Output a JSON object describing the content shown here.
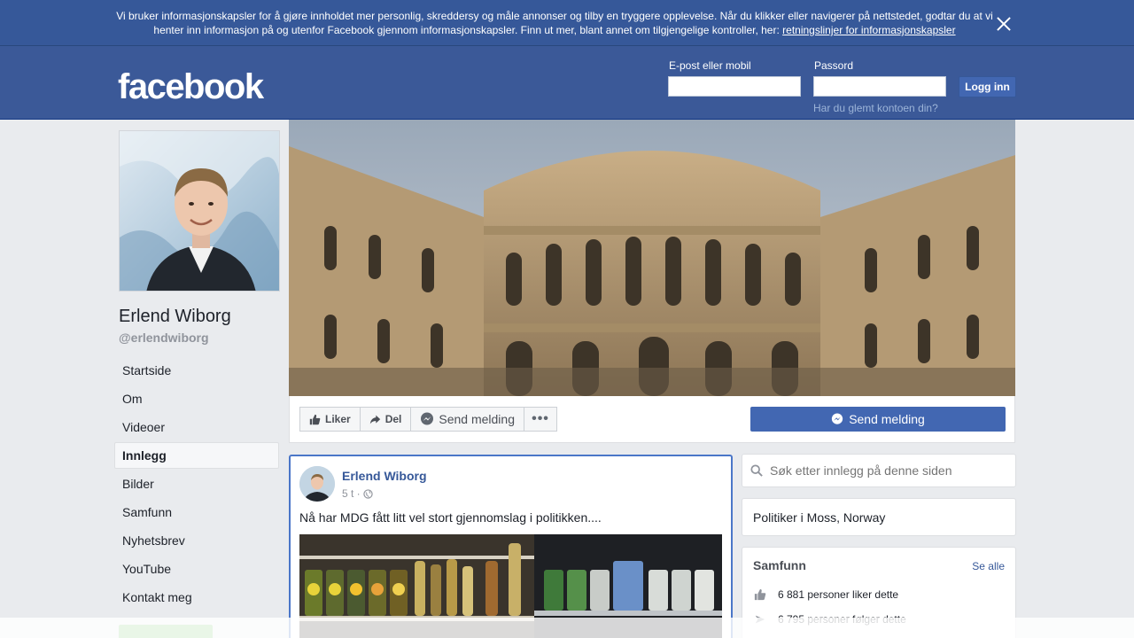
{
  "cookie_banner": {
    "text": "Vi bruker informasjonskapsler for å gjøre innholdet mer personlig, skreddersy og måle annonser og tilby en tryggere opplevelse. Når du klikker eller navigerer på nettstedet, godtar du at vi henter inn informasjon på og utenfor Facebook gjennom informasjonskapsler. Finn ut mer, blant annet om tilgjengelige kontroller, her: ",
    "link": "retningslinjer for informasjonskapsler"
  },
  "header": {
    "logo": "facebook",
    "email_label": "E-post eller mobil",
    "password_label": "Passord",
    "login_button": "Logg inn",
    "forgot": "Har du glemt kontoen din?"
  },
  "profile": {
    "name": "Erlend Wiborg",
    "handle": "@erlendwiborg"
  },
  "nav": {
    "items": [
      {
        "label": "Startside"
      },
      {
        "label": "Om"
      },
      {
        "label": "Videoer"
      },
      {
        "label": "Innlegg"
      },
      {
        "label": "Bilder"
      },
      {
        "label": "Samfunn"
      },
      {
        "label": "Nyhetsbrev"
      },
      {
        "label": "YouTube"
      },
      {
        "label": "Kontakt meg"
      }
    ],
    "active": "Innlegg"
  },
  "actions": {
    "like": "Liker",
    "share": "Del",
    "message": "Send melding",
    "more": "•••",
    "send_main": "Send melding"
  },
  "post": {
    "author": "Erlend Wiborg",
    "time": "5 t ·",
    "text": "Nå har MDG fått litt vel stort gjennomslag i politikken...."
  },
  "sidebar": {
    "search_placeholder": "Søk etter innlegg på denne siden",
    "category": "Politiker i Moss, Norway",
    "community_title": "Samfunn",
    "see_all": "Se alle",
    "likes": "6 881 personer liker dette",
    "follows": "6 795 personer følger dette"
  },
  "colors": {
    "brand": "#3b5998",
    "button": "#4267b2",
    "link": "#365899"
  }
}
